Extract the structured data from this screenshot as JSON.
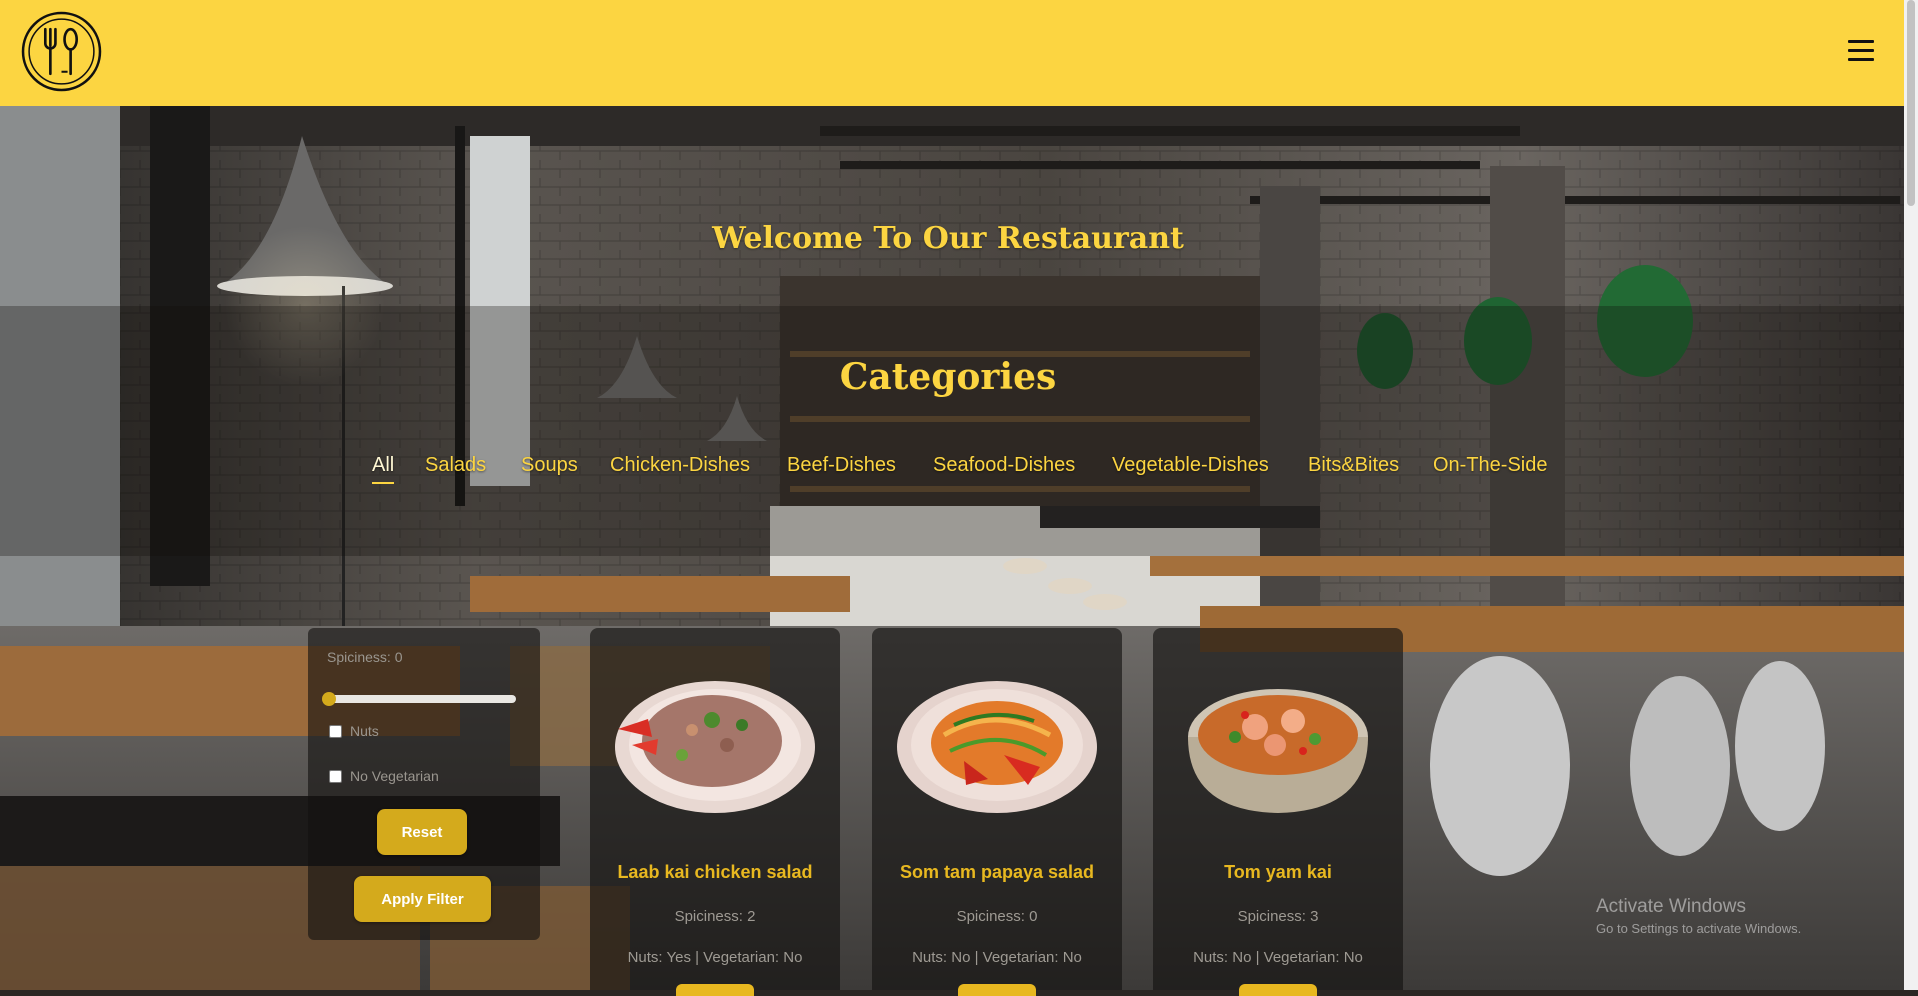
{
  "header": {
    "logo_icon": "fork-spoon-logo-icon",
    "menu_icon": "hamburger-menu-icon",
    "background_color": "#fcd541"
  },
  "hero": {
    "welcome_title": "Welcome To Our Restaurant"
  },
  "categories": {
    "title": "Categories",
    "tabs": [
      "All",
      "Salads",
      "Soups",
      "Chicken-Dishes",
      "Beef-Dishes",
      "Seafood-Dishes",
      "Vegetable-Dishes",
      "Bits&Bites",
      "On-The-Side"
    ],
    "active_tab": "All"
  },
  "filter": {
    "spiciness_label": "Spiciness: 0",
    "spiciness_value": 0,
    "nuts_label": "Nuts",
    "no_vegetarian_label": "No Vegetarian",
    "reset_label": "Reset",
    "apply_label": "Apply Filter"
  },
  "dishes": [
    {
      "name": "Laab kai chicken salad",
      "spiciness": "Spiciness: 2",
      "meta": "Nuts: Yes | Vegetarian: No"
    },
    {
      "name": "Som tam papaya salad",
      "spiciness": "Spiciness: 0",
      "meta": "Nuts: No | Vegetarian: No"
    },
    {
      "name": "Tom yam kai",
      "spiciness": "Spiciness: 3",
      "meta": "Nuts: No | Vegetarian: No"
    }
  ],
  "watermark": {
    "line1": "Activate Windows",
    "line2": "Go to Settings to activate Windows."
  },
  "colors": {
    "accent": "#fcd541",
    "button": "#d4aa1c",
    "dish_title": "#e8b820"
  }
}
